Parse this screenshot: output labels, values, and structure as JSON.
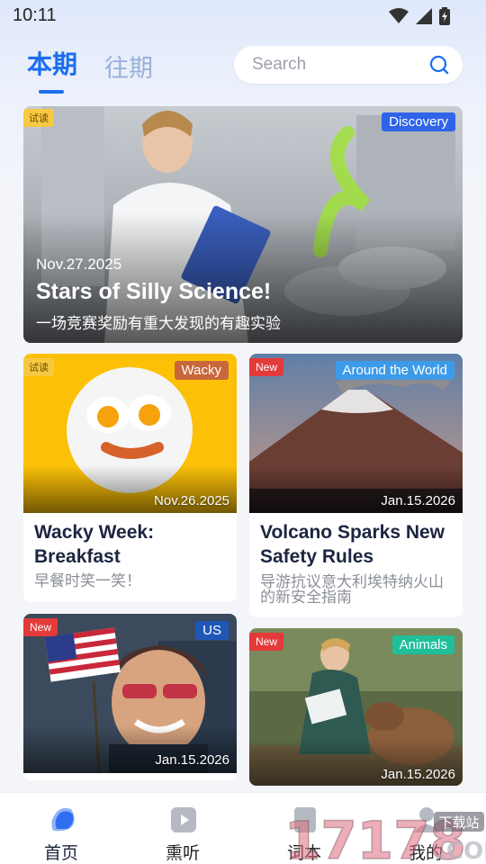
{
  "status_bar": {
    "time": "10:11"
  },
  "header": {
    "tab_current": "本期",
    "tab_past": "往期",
    "search_placeholder": "Search"
  },
  "colors": {
    "accent": "#1c6ef0",
    "badge_new": "#e43a3a",
    "badge_trial": "#f7c842"
  },
  "featured": {
    "trial_badge": "试读",
    "category": "Discovery",
    "date": "Nov.27.2025",
    "title": "Stars of Silly Science!",
    "subtitle": "一场竞赛奖励有重大发现的有趣实验"
  },
  "cards": [
    {
      "badge": "试读",
      "category": "Wacky",
      "date": "Nov.26.2025",
      "title": "Wacky Week: Breakfast",
      "subtitle": "早餐时笑一笑！"
    },
    {
      "badge": "New",
      "category": "Around the World",
      "date": "Jan.15.2026",
      "title": "Volcano Sparks New Safety Rules",
      "subtitle": "导游抗议意大利埃特纳火山的新安全指南"
    },
    {
      "badge": "New",
      "category": "US",
      "date": "Jan.15.2026"
    },
    {
      "badge": "New",
      "category": "Animals",
      "date": "Jan.15.2026"
    }
  ],
  "nav": {
    "items": [
      {
        "label": "首页",
        "icon": "home-icon"
      },
      {
        "label": "熏听",
        "icon": "play-icon"
      },
      {
        "label": "词本",
        "icon": "wordbook-icon"
      },
      {
        "label": "我的",
        "icon": "profile-icon"
      }
    ]
  },
  "watermark": {
    "text": "17178",
    "tag": "下载站",
    "suffix": ".COM"
  }
}
